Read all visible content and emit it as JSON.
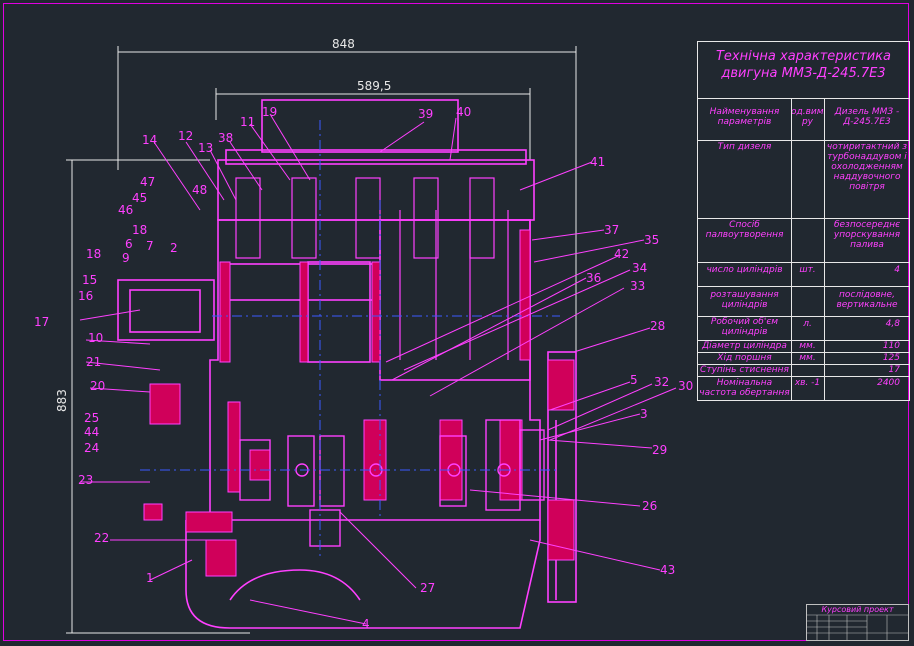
{
  "dimensions": {
    "overall_width": "848",
    "upper_width": "589,5",
    "height": "883"
  },
  "spec": {
    "title_line1": "Технічна характеристика",
    "title_line2": "двигуна ММЗ-Д-245.7Е3",
    "header_param": "Найменування параметрів",
    "header_unit": "од.вимі ру",
    "header_value": "Дизель ММЗ - Д-245.7Е3",
    "rows": [
      {
        "param": "Тип дизеля",
        "unit": "",
        "value": "чотиритактний з турбонаддувом і охолодженням наддувочного повітря"
      },
      {
        "param": "Спосіб палвоутворення",
        "unit": "",
        "value": "безпосереднє упорскування палива"
      },
      {
        "param": "число циліндрів",
        "unit": "шт.",
        "value": "4"
      },
      {
        "param": "розташування циліндрів",
        "unit": "",
        "value": "послідовне, вертикальне"
      },
      {
        "param": "Робочий об'єм циліндрів",
        "unit": "л.",
        "value": "4,8"
      },
      {
        "param": "Діаметр циліндра",
        "unit": "мм.",
        "value": "110"
      },
      {
        "param": "Хід поршня",
        "unit": "мм.",
        "value": "125"
      },
      {
        "param": "Ступінь стиснення",
        "unit": "",
        "value": "17"
      },
      {
        "param": "Номінальна частота обертання",
        "unit": "хв. -1",
        "value": "2400"
      }
    ]
  },
  "stamp": {
    "title": "Курсовий проект"
  },
  "callouts": [
    "1",
    "2",
    "3",
    "4",
    "5",
    "6",
    "7",
    "9",
    "10",
    "11",
    "12",
    "13",
    "14",
    "15",
    "16",
    "17",
    "18",
    "18",
    "19",
    "20",
    "21",
    "22",
    "23",
    "24",
    "25",
    "26",
    "27",
    "28",
    "29",
    "30",
    "32",
    "33",
    "34",
    "35",
    "36",
    "37",
    "38",
    "39",
    "40",
    "41",
    "42",
    "43",
    "44",
    "45",
    "46",
    "47",
    "48"
  ],
  "colors": {
    "background": "#212830",
    "part_lines": "#ff40ff",
    "section_fill": "#d0005a",
    "axis": "#3a5aff",
    "dimension_lines": "#e8e8e8"
  }
}
